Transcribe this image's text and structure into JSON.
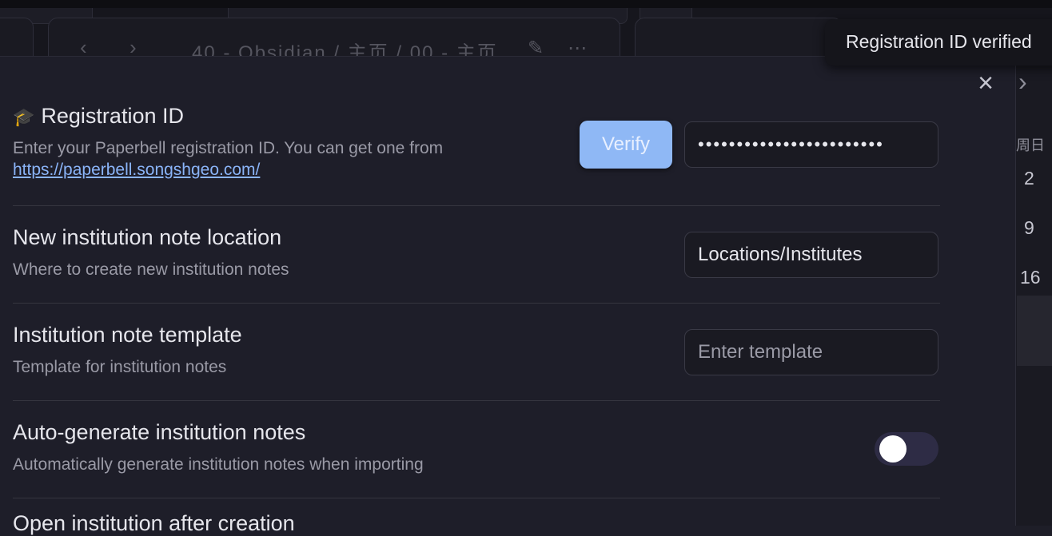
{
  "toast": {
    "text": "Registration ID verified"
  },
  "nav": {
    "path": "40 - Obsidian / 主页 / 00 - 主页"
  },
  "settings": [
    {
      "emoji": "🎓",
      "title": "Registration ID",
      "description": "Enter your Paperbell registration ID. You can get one from",
      "link": "https://paperbell.songshgeo.com/",
      "button_label": "Verify",
      "value": "••••••••••••••••••••••••"
    },
    {
      "title": "New institution note location",
      "description": "Where to create new institution notes",
      "value": "Locations/Institutes"
    },
    {
      "title": "Institution note template",
      "description": "Template for institution notes",
      "placeholder": "Enter template"
    },
    {
      "title": "Auto-generate institution notes",
      "description": "Automatically generate institution notes when importing",
      "toggle_on": false
    },
    {
      "title": "Open institution after creation"
    }
  ],
  "calendar": {
    "header": "周日",
    "days": [
      "2",
      "9",
      "16"
    ]
  }
}
